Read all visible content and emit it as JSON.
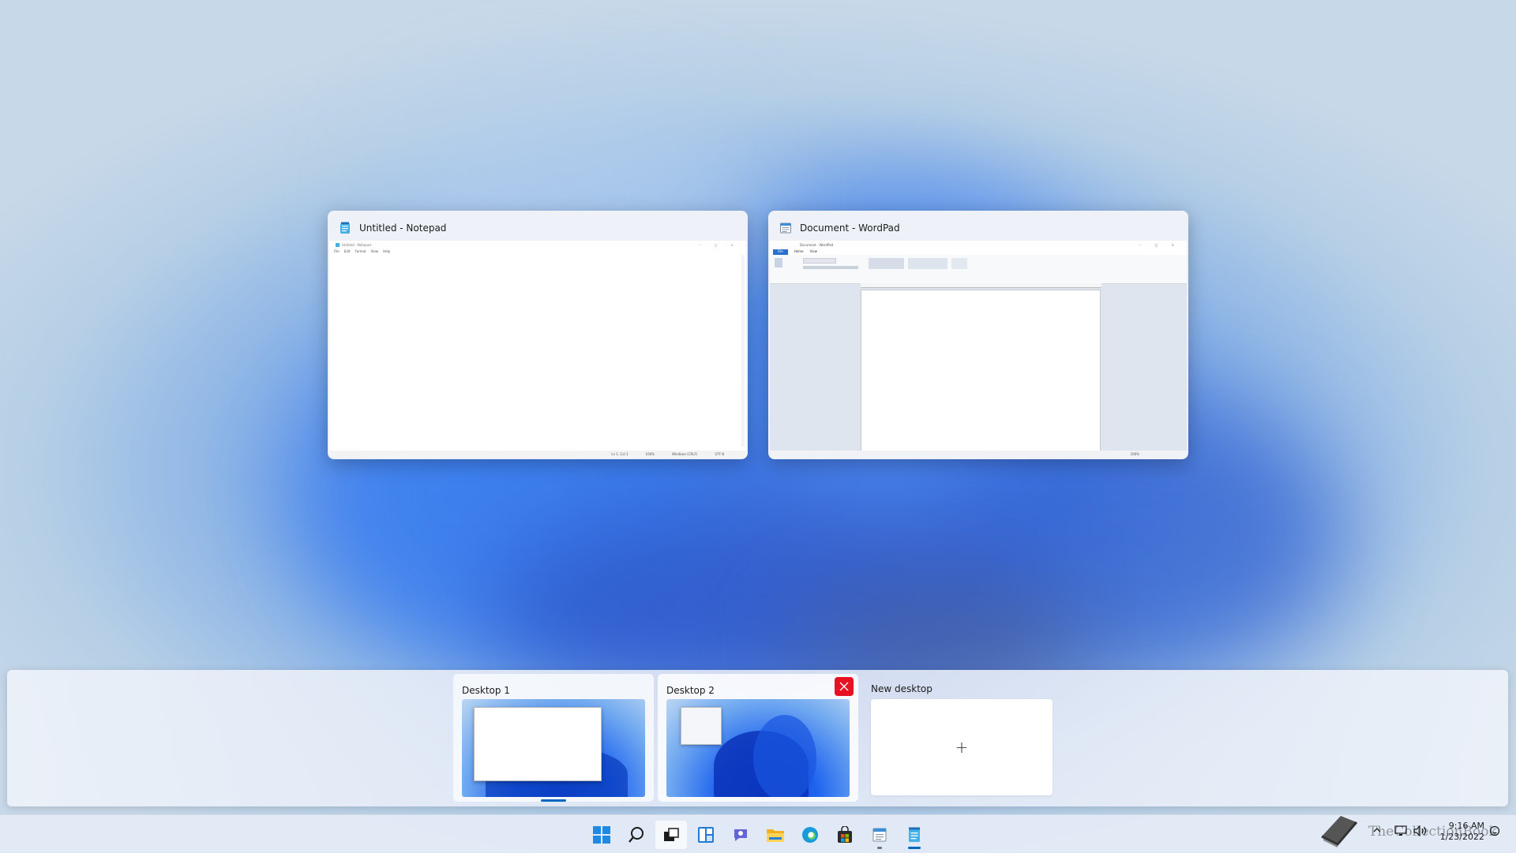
{
  "colors": {
    "accent": "#0067c0",
    "close_red": "#e81123"
  },
  "windows": [
    {
      "title": "Untitled - Notepad",
      "icon": "notepad-icon",
      "mini_title": "Untitled - Notepad",
      "menu": [
        "File",
        "Edit",
        "Format",
        "View",
        "Help"
      ],
      "status": [
        "Ln 1, Col 1",
        "100%",
        "Windows (CRLF)",
        "UTF-8"
      ]
    },
    {
      "title": "Document - WordPad",
      "icon": "wordpad-icon",
      "mini_title": "Document - WordPad",
      "tabs": [
        "File",
        "Home",
        "View"
      ],
      "zoom": "100%"
    }
  ],
  "desktops": [
    {
      "label": "Desktop 1",
      "current": true
    },
    {
      "label": "Desktop 2",
      "hovered": true,
      "close_icon": "close-icon"
    },
    {
      "label": "New desktop",
      "add_icon": "plus-icon",
      "add_glyph": "+"
    }
  ],
  "taskbar": {
    "icons": [
      "start-icon",
      "search-icon",
      "task-view-icon",
      "widgets-icon",
      "chat-icon",
      "file-explorer-icon",
      "edge-icon",
      "store-icon",
      "wordpad-icon",
      "notepad-icon"
    ],
    "clock_time": "9:16 AM",
    "clock_date": "1/23/2022",
    "tray_icons": [
      "chevron-up-icon",
      "network-icon",
      "volume-icon",
      "notification-icon"
    ]
  },
  "watermark": "TheCollectionBook"
}
